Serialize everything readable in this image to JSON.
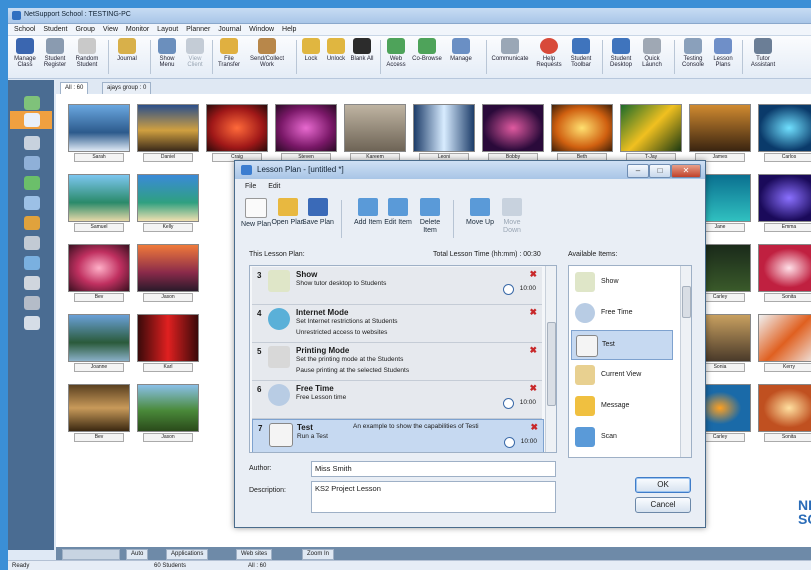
{
  "app": {
    "title": "NetSupport School : TESTING-PC"
  },
  "menu": [
    "School",
    "Student",
    "Group",
    "View",
    "Monitor",
    "Layout",
    "Planner",
    "Journal",
    "Window",
    "Help"
  ],
  "toolbar": [
    {
      "label": "Manage Class"
    },
    {
      "label": "Student Register"
    },
    {
      "label": "Random Student"
    },
    {
      "label": "Journal"
    },
    {
      "label": "Show Menu"
    },
    {
      "label": "View Client"
    },
    {
      "label": "File Transfer"
    },
    {
      "label": "Send/Collect Work"
    },
    {
      "label": "Lock"
    },
    {
      "label": "Unlock"
    },
    {
      "label": "Blank All"
    },
    {
      "label": "Web Access"
    },
    {
      "label": "Co-Browse"
    },
    {
      "label": "Manage"
    },
    {
      "label": "Communicate"
    },
    {
      "label": "Help Requests"
    },
    {
      "label": "Student Toolbar"
    },
    {
      "label": "Student Desktop"
    },
    {
      "label": "Quick Launch"
    },
    {
      "label": "Testing Console"
    },
    {
      "label": "Lesson Plans"
    },
    {
      "label": "Tutor Assistant"
    }
  ],
  "tabs": [
    {
      "label": "All : 60"
    },
    {
      "label": "ajays group : 0"
    }
  ],
  "students": [
    "Sarah",
    "Daniel",
    "Craig",
    "Steven",
    "Kareem",
    "Leoni",
    "Bobby",
    "Beth",
    "T-Jay",
    "James",
    "Carlos",
    "Samuel",
    "Kelly",
    "Jane",
    "Emma",
    "Bev",
    "Jason",
    "Carley",
    "Sonita",
    "Joanne",
    "Karl",
    "Sonia",
    "Kerry",
    "Bev",
    "Jason",
    "Carley",
    "Sonita"
  ],
  "bottombar": {
    "auto": "Auto",
    "applications": "Applications",
    "websites": "Web sites",
    "zoom": "Zoom In"
  },
  "status": {
    "ready": "Ready",
    "students": "60 Students",
    "all": "All : 60"
  },
  "logo": "NE SC",
  "dialog": {
    "title": "Lesson Plan - [untitled *]",
    "menu": [
      "File",
      "Edit"
    ],
    "tools": [
      {
        "label": "New Plan"
      },
      {
        "label": "Open Plan"
      },
      {
        "label": "Save Plan"
      },
      {
        "label": "Add Item"
      },
      {
        "label": "Edit Item"
      },
      {
        "label": "Delete Item"
      },
      {
        "label": "Move Up"
      },
      {
        "label": "Move Down"
      }
    ],
    "this_lesson_plan": "This Lesson Plan:",
    "total_time": "Total Lesson Time (hh:mm) : 00:30",
    "available_items": "Available Items:",
    "items": [
      {
        "num": "3",
        "name": "Show",
        "desc": "Show tutor desktop to Students",
        "desc2": "",
        "time": "10:00"
      },
      {
        "num": "4",
        "name": "Internet Mode",
        "desc": "Set Internet restrictions at Students",
        "desc2": "Unrestricted access to websites",
        "time": ""
      },
      {
        "num": "5",
        "name": "Printing Mode",
        "desc": "Set the printing mode at the Students",
        "desc2": "Pause printing at the selected Students",
        "time": ""
      },
      {
        "num": "6",
        "name": "Free Time",
        "desc": "Free Lesson time",
        "desc2": "",
        "time": "10:00"
      },
      {
        "num": "7",
        "name": "Test",
        "desc": "Run a Test",
        "desc2": "",
        "time": "10:00",
        "extra": "An example to show the capabilities of Testi"
      }
    ],
    "available": [
      "Show",
      "Free Time",
      "Test",
      "Current View",
      "Message",
      "Scan"
    ],
    "author_label": "Author:",
    "author_value": "Miss Smith",
    "description_label": "Description:",
    "description_value": "KS2 Project Lesson",
    "ok": "OK",
    "cancel": "Cancel"
  },
  "colors": {
    "accent": "#3b8fd6",
    "sidebar": "#4a6c92",
    "selected": "#c6d9f1",
    "close": "#c8282a"
  }
}
